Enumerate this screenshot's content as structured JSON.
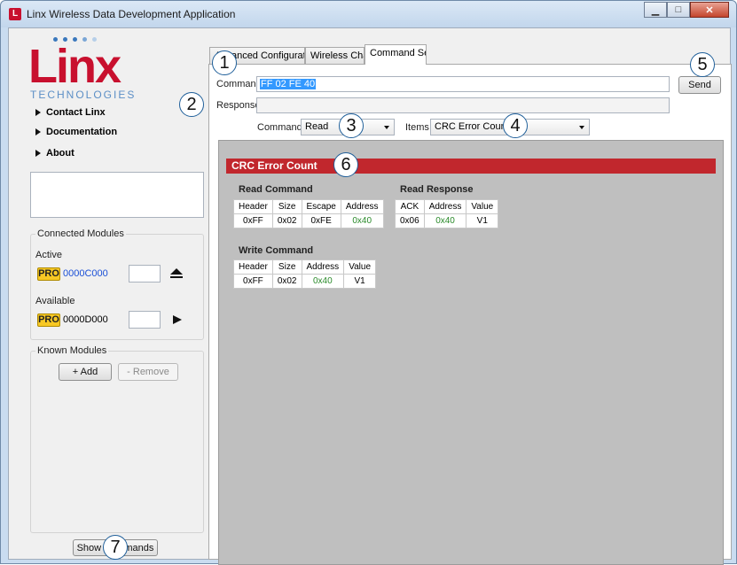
{
  "window": {
    "title": "Linx Wireless Data Development Application",
    "controls": [
      "minimize-icon",
      "maximize-icon",
      "close-icon"
    ]
  },
  "logo": {
    "word": "Linx",
    "sub": "TECHNOLOGIES"
  },
  "sidebar": {
    "nav": [
      {
        "label": "Contact Linx"
      },
      {
        "label": "Documentation"
      },
      {
        "label": "About"
      }
    ],
    "connected_modules": {
      "label": "Connected Modules",
      "active_label": "Active",
      "active": {
        "badge": "PRO",
        "id": "0000C000",
        "id_color": "#1a4fd6"
      },
      "available_label": "Available",
      "available": {
        "badge": "PRO",
        "id": "0000D000"
      }
    },
    "known_modules": {
      "label": "Known Modules",
      "add_label": "+ Add",
      "remove_label": "- Remove"
    },
    "show_commands_label": "Show Commands"
  },
  "tabs": [
    {
      "label": "Advanced Configuration"
    },
    {
      "label": "Wireless Chat"
    },
    {
      "label": "Command Set",
      "active": true
    }
  ],
  "command_set": {
    "command_label": "Command",
    "command_value": "FF 02 FE 40",
    "response_label": "Response",
    "response_value": "",
    "send_label": "Send",
    "commands_label": "Commands",
    "commands_value": "Read",
    "items_label": "Items",
    "items_value": "CRC Error Count",
    "section_title": "CRC Error Count",
    "read_command": {
      "title": "Read Command",
      "headers": [
        "Header",
        "Size",
        "Escape",
        "Address"
      ],
      "values": [
        "0xFF",
        "0x02",
        "0xFE",
        "0x40"
      ]
    },
    "read_response": {
      "title": "Read Response",
      "headers": [
        "ACK",
        "Address",
        "Value"
      ],
      "values": [
        "0x06",
        "0x40",
        "V1"
      ]
    },
    "write_command": {
      "title": "Write Command",
      "headers": [
        "Header",
        "Size",
        "Address",
        "Value"
      ],
      "values": [
        "0xFF",
        "0x02",
        "0x40",
        "V1"
      ]
    }
  },
  "callouts": [
    "1",
    "2",
    "3",
    "4",
    "5",
    "6",
    "7"
  ],
  "colors": {
    "brand_red": "#c8102e",
    "section_red": "#c1272d",
    "address_green": "#2a8a2a",
    "badge_yellow": "#f7c824"
  }
}
